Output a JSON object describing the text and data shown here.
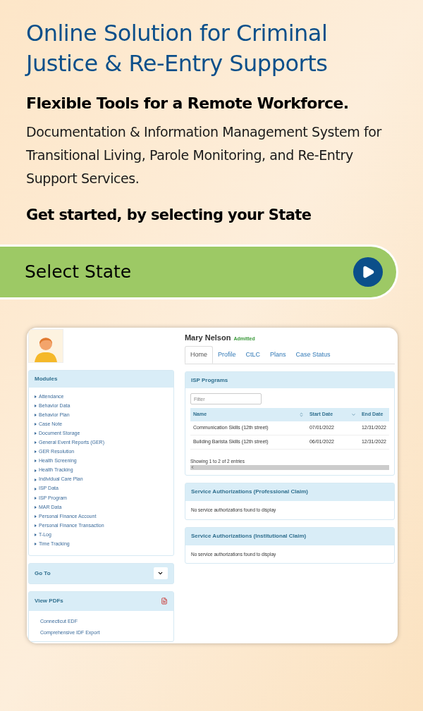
{
  "headline": "Online Solution for Criminal Justice & Re-Entry Supports",
  "tagline": "Flexible Tools for a Remote Workforce.",
  "description": "Documentation & Information Management System for Transitional Living, Parole Monitoring, and Re-Entry Support Services.",
  "prompt": "Get started, by selecting your State",
  "select_state": {
    "label": "Select State"
  },
  "app": {
    "modules": {
      "title": "Modules",
      "items": [
        "Attendance",
        "Behavior Data",
        "Behavior Plan",
        "Case Note",
        "Document Storage",
        "General Event Reports (GER)",
        "GER Resolution",
        "Health Screening",
        "Health Tracking",
        "Individual Care Plan",
        "ISP Data",
        "ISP Program",
        "MAR Data",
        "Personal Finance Account",
        "Personal Finance Transaction",
        "T-Log",
        "Time Tracking"
      ]
    },
    "goto": {
      "title": "Go To"
    },
    "pdfs": {
      "title": "View PDFs",
      "items": [
        "Connecticut EDF",
        "Comprehensive IDF Export"
      ]
    },
    "client": {
      "name": "Mary Nelson",
      "status": "Admitted"
    },
    "tabs": [
      {
        "label": "Home",
        "selected": true
      },
      {
        "label": "Profile",
        "selected": false
      },
      {
        "label": "CtLC",
        "selected": false
      },
      {
        "label": "Plans",
        "selected": false
      },
      {
        "label": "Case Status",
        "selected": false
      }
    ],
    "isp": {
      "title": "ISP Programs",
      "filter_placeholder": "Filter",
      "columns": [
        "Name",
        "Start Date",
        "End Date"
      ],
      "rows": [
        [
          "Communication Skills (12th street)",
          "07/01/2022",
          "12/31/2022"
        ],
        [
          "Building Barista Skills (12th street)",
          "06/01/2022",
          "12/31/2022"
        ]
      ],
      "footer": "Showing 1 to 2 of 2 entries"
    },
    "panels": [
      {
        "title": "Service Authorizations (Professional Claim)",
        "message": "No service authorizations found to display"
      },
      {
        "title": "Service Authorizations (Institutional Claim)",
        "message": "No service authorizations found to display"
      }
    ]
  }
}
